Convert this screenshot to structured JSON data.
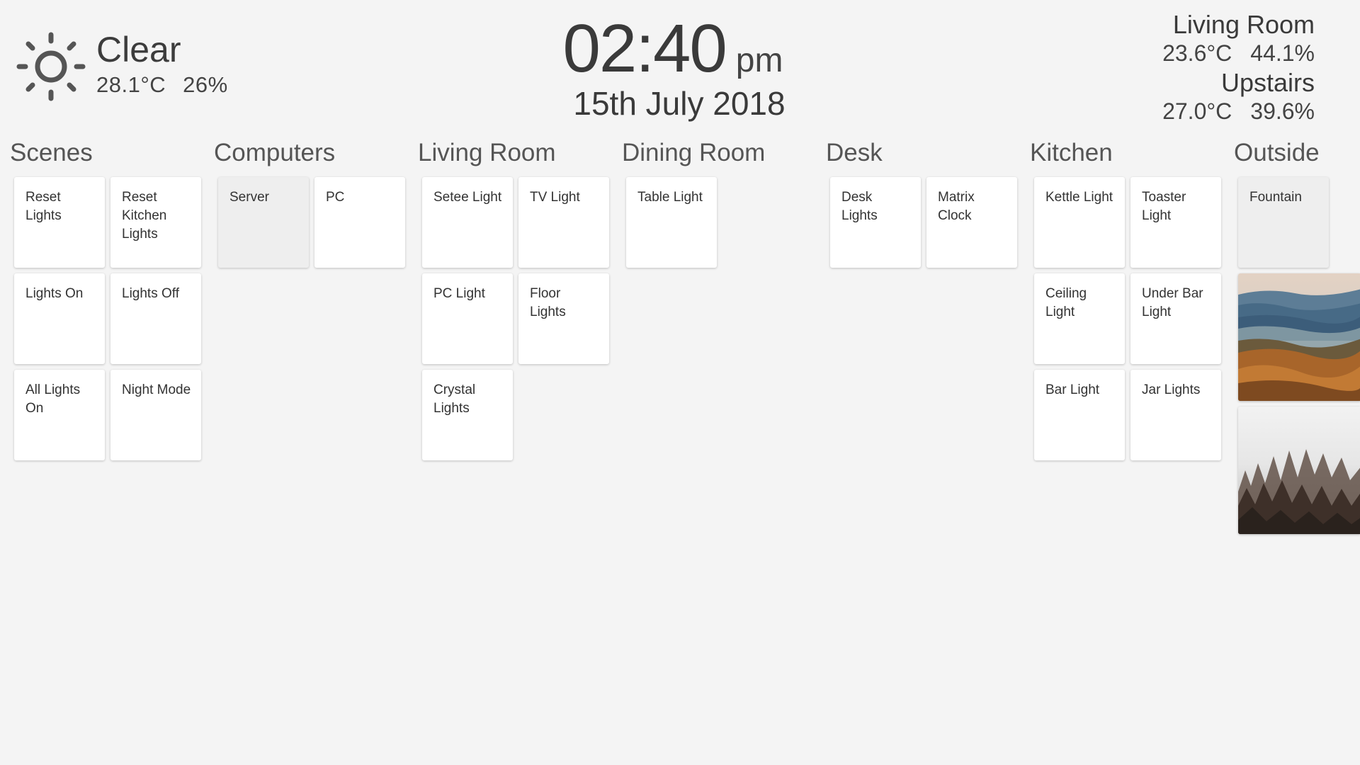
{
  "weather": {
    "condition": "Clear",
    "temperature": "28.1°C",
    "humidity": "26%",
    "icon": "sun-icon"
  },
  "clock": {
    "time": "02:40",
    "ampm": "pm",
    "date": "15th July 2018"
  },
  "sensors": [
    {
      "room": "Living Room",
      "temperature": "23.6°C",
      "humidity": "44.1%"
    },
    {
      "room": "Upstairs",
      "temperature": "27.0°C",
      "humidity": "39.6%"
    }
  ],
  "sections": {
    "scenes": {
      "title": "Scenes",
      "tiles": [
        "Reset Lights",
        "Reset Kitchen Lights",
        "Lights On",
        "Lights Off",
        "All Lights On",
        "Night Mode"
      ]
    },
    "computers": {
      "title": "Computers",
      "tiles": [
        "Server",
        "PC"
      ]
    },
    "living_room": {
      "title": "Living Room",
      "tiles": [
        "Setee Light",
        "TV Light",
        "PC Light",
        "Floor Lights",
        "Crystal Lights"
      ]
    },
    "dining_room": {
      "title": "Dining Room",
      "tiles": [
        "Table Light"
      ]
    },
    "desk": {
      "title": "Desk",
      "tiles": [
        "Desk Lights",
        "Matrix Clock"
      ]
    },
    "kitchen": {
      "title": "Kitchen",
      "tiles": [
        "Kettle Light",
        "Toaster Light",
        "Ceiling Light",
        "Under Bar Light",
        "Bar Light",
        "Jar Lights"
      ]
    },
    "outside": {
      "title": "Outside",
      "tiles": [
        "Fountain"
      ]
    }
  },
  "colors": {
    "background": "#f4f4f4",
    "tile_on": "#ffffff",
    "tile_off": "#eeeeee",
    "text": "#444444"
  }
}
